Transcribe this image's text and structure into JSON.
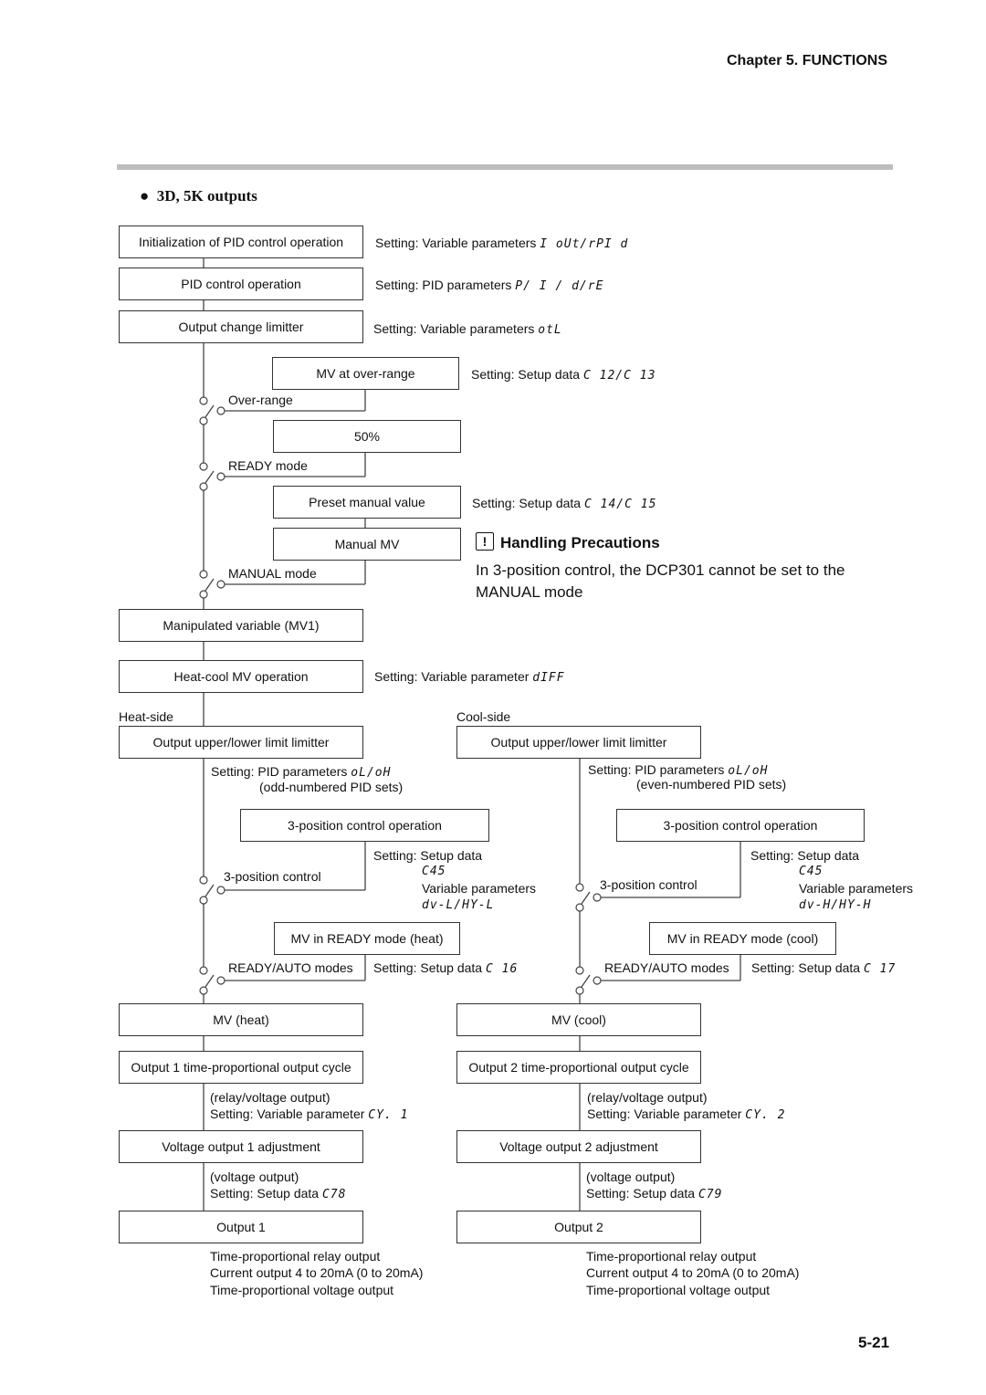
{
  "header": {
    "chapter": "Chapter 5. FUNCTIONS",
    "section": "3D, 5K outputs"
  },
  "boxes": {
    "init": "Initialization of PID control operation",
    "pid": "PID control operation",
    "olim": "Output change limitter",
    "mvover": "MV at over-range",
    "fifty": "50%",
    "preset": "Preset manual value",
    "manualmv": "Manual MV",
    "mv1": "Manipulated variable (MV1)",
    "heatcool": "Heat-cool MV operation",
    "limheat": "Output upper/lower limit limitter",
    "limcool": "Output upper/lower limit limitter",
    "pos3heat": "3-position control operation",
    "pos3cool": "3-position control operation",
    "readyheat": "MV in READY mode (heat)",
    "readycool": "MV in READY mode (cool)",
    "mvheat": "MV (heat)",
    "mvcool": "MV (cool)",
    "cyc1": "Output 1 time-proportional output cycle",
    "cyc2": "Output 2 time-proportional output cycle",
    "volt1": "Voltage output 1 adjustment",
    "volt2": "Voltage output 2 adjustment",
    "out1": "Output 1",
    "out2": "Output 2"
  },
  "settings": {
    "init": {
      "label": "Setting: Variable parameters",
      "code": "I oUt/rPI d"
    },
    "pid": {
      "label": "Setting: PID parameters",
      "code": "P/ I / d/rE"
    },
    "olim": {
      "label": "Setting: Variable parameters",
      "code": "otL"
    },
    "mvover": {
      "label": "Setting: Setup data",
      "code": "C 12/C 13"
    },
    "preset": {
      "label": "Setting: Setup data",
      "code": "C 14/C 15"
    },
    "heatcool": {
      "label": "Setting: Variable parameter",
      "code": "dIFF"
    },
    "limheat": {
      "label": "Setting: PID parameters",
      "code": "oL/oH",
      "note": "(odd-numbered PID sets)"
    },
    "limcool": {
      "label": "Setting: PID parameters",
      "code": "oL/oH",
      "note": "(even-numbered PID sets)"
    },
    "pos3heat": {
      "label": "Setting: Setup data",
      "code": "C45",
      "label2": "Variable parameters",
      "code2": "dv-L/HY-L"
    },
    "pos3cool": {
      "label": "Setting: Setup data",
      "code": "C45",
      "label2": "Variable parameters",
      "code2": "dv-H/HY-H"
    },
    "readyheat": {
      "label": "Setting: Setup data",
      "code": "C 16"
    },
    "readycool": {
      "label": "Setting: Setup data",
      "code": "C 17"
    },
    "cyc1": {
      "note": "(relay/voltage output)",
      "label": "Setting: Variable parameter",
      "code": "CY. 1"
    },
    "cyc2": {
      "note": "(relay/voltage output)",
      "label": "Setting: Variable parameter",
      "code": "CY. 2"
    },
    "volt1": {
      "note": "(voltage output)",
      "label": "Setting: Setup data",
      "code": "C78"
    },
    "volt2": {
      "note": "(voltage output)",
      "label": "Setting: Setup data",
      "code": "C79"
    }
  },
  "switches": {
    "overrange": "Over-range",
    "ready": "READY mode",
    "manual": "MANUAL mode",
    "pos3heat": "3-position control",
    "pos3cool": "3-position control",
    "autoheat": "READY/AUTO modes",
    "autocool": "READY/AUTO modes"
  },
  "sides": {
    "heat": "Heat-side",
    "cool": "Cool-side"
  },
  "outputs": [
    "Time-proportional relay output",
    "Current output 4 to 20mA (0 to 20mA)",
    "Time-proportional voltage output"
  ],
  "precaution": {
    "title": "Handling Precautions",
    "icon": "!",
    "line1": "In 3-position control, the DCP301 cannot be set to the",
    "line2": "MANUAL mode"
  },
  "page_number": "5-21"
}
